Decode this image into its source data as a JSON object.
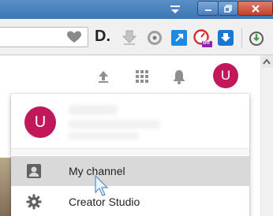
{
  "window": {
    "controls": [
      "minimize-icon",
      "maximize-icon",
      "close-icon"
    ],
    "dropdown_icon": "tab-list-icon"
  },
  "toolbar": {
    "bookmark_icon": "heart-icon",
    "extension_d_label": "D.",
    "extension_icons": [
      "download-arrow-icon",
      "music-disc-icon",
      "external-link-icon",
      "speed-gauge-icon",
      "download-blue-icon",
      "timer-download-icon"
    ],
    "off_badge": "off"
  },
  "masthead": {
    "upload_icon": "upload-icon",
    "apps_icon": "apps-grid-icon",
    "notifications_icon": "bell-icon",
    "avatar_letter": "U",
    "avatar_color": "#c2185b"
  },
  "account_menu": {
    "avatar_letter": "U",
    "items": [
      {
        "label": "My channel",
        "icon": "account-box-icon",
        "hovered": true
      },
      {
        "label": "Creator Studio",
        "icon": "gear-icon",
        "hovered": false
      }
    ]
  }
}
